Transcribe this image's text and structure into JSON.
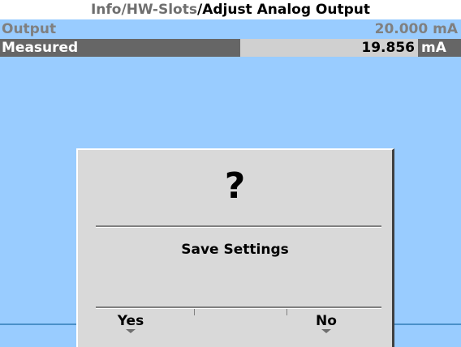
{
  "header": {
    "path": "Info/HW-Slots",
    "separator": "/",
    "page": "Adjust Analog Output"
  },
  "rows": [
    {
      "label": "Output",
      "value": "20.000 mA"
    },
    {
      "label": "Measured",
      "value": "19.856",
      "unit": "mA"
    }
  ],
  "dialog": {
    "icon": "question-mark-icon",
    "icon_glyph": "?",
    "message": "Save Settings",
    "buttons": {
      "yes": "Yes",
      "no": "No"
    }
  },
  "colors": {
    "background": "#99ccff",
    "header": "#ffffff",
    "selected_row": "#666666",
    "value_box": "#d0d0d0",
    "dialog": "#d9d9d9"
  }
}
